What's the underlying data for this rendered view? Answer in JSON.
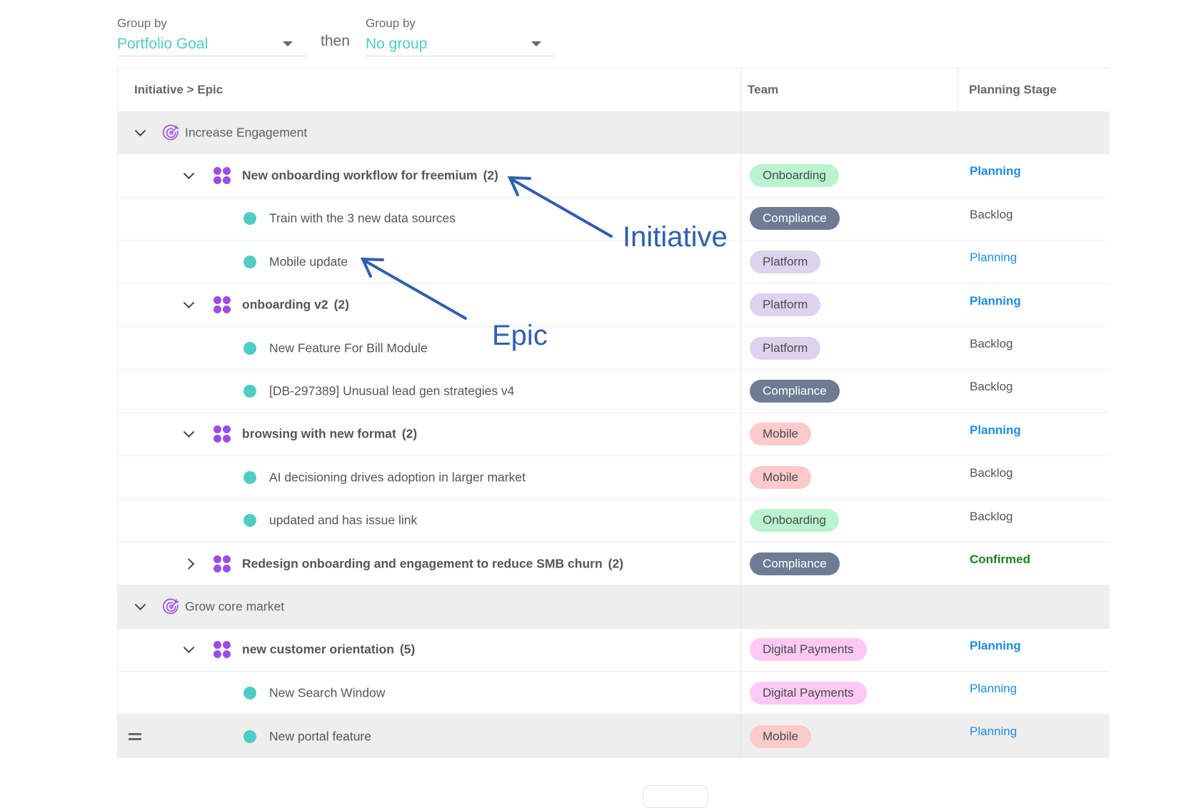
{
  "group_by_1": {
    "label": "Group by",
    "value": "Portfolio Goal"
  },
  "then_label": "then",
  "group_by_2": {
    "label": "Group by",
    "value": "No group"
  },
  "columns": {
    "name": "Initiative > Epic",
    "team": "Team",
    "stage": "Planning Stage"
  },
  "team_colors": {
    "Onboarding": {
      "bg": "#b9f3d0",
      "fg": "#4a4a4a"
    },
    "Compliance": {
      "bg": "#6e7b94",
      "fg": "#ffffff"
    },
    "Platform": {
      "bg": "#ddd3ee",
      "fg": "#4a4a4a"
    },
    "Mobile": {
      "bg": "#fbcaca",
      "fg": "#4a4a4a"
    },
    "Digital Payments": {
      "bg": "#fbc9f4",
      "fg": "#4a4a4a"
    }
  },
  "rows": [
    {
      "type": "goal",
      "label": "Increase Engagement",
      "expanded": true
    },
    {
      "type": "initiative",
      "label": "New onboarding workflow for freemium",
      "count": "(2)",
      "expanded": true,
      "team": "Onboarding",
      "stage": "Planning",
      "stage_style": "planning",
      "stage_bold": true
    },
    {
      "type": "epic",
      "label": "Train with the 3 new data sources",
      "team": "Compliance",
      "stage": "Backlog",
      "stage_style": "backlog"
    },
    {
      "type": "epic",
      "label": "Mobile update",
      "team": "Platform",
      "stage": "Planning",
      "stage_style": "planning"
    },
    {
      "type": "initiative",
      "label": "onboarding v2",
      "count": "(2)",
      "expanded": true,
      "team": "Platform",
      "stage": "Planning",
      "stage_style": "planning",
      "stage_bold": true
    },
    {
      "type": "epic",
      "label": "New Feature For Bill Module",
      "team": "Platform",
      "stage": "Backlog",
      "stage_style": "backlog"
    },
    {
      "type": "epic",
      "label": "[DB-297389] Unusual lead gen strategies v4",
      "team": "Compliance",
      "stage": "Backlog",
      "stage_style": "backlog"
    },
    {
      "type": "initiative",
      "label": "browsing with new format",
      "count": "(2)",
      "expanded": true,
      "team": "Mobile",
      "stage": "Planning",
      "stage_style": "planning",
      "stage_bold": true
    },
    {
      "type": "epic",
      "label": "AI decisioning drives adoption in larger market",
      "team": "Mobile",
      "stage": "Backlog",
      "stage_style": "backlog"
    },
    {
      "type": "epic",
      "label": "updated and has issue link",
      "team": "Onboarding",
      "stage": "Backlog",
      "stage_style": "backlog"
    },
    {
      "type": "initiative",
      "label": "Redesign onboarding and engagement to reduce SMB churn",
      "count": "(2)",
      "expanded": false,
      "team": "Compliance",
      "stage": "Confirmed",
      "stage_style": "confirmed",
      "stage_bold": true
    },
    {
      "type": "goal",
      "label": "Grow core market",
      "expanded": true
    },
    {
      "type": "initiative",
      "label": "new customer orientation",
      "count": "(5)",
      "expanded": true,
      "team": "Digital Payments",
      "stage": "Planning",
      "stage_style": "planning",
      "stage_bold": true
    },
    {
      "type": "epic",
      "label": "New Search Window",
      "team": "Digital Payments",
      "stage": "Planning",
      "stage_style": "planning"
    },
    {
      "type": "epic",
      "label": "New portal feature",
      "team": "Mobile",
      "stage": "Planning",
      "stage_style": "planning",
      "highlighted": true,
      "drag_handle": true
    }
  ],
  "annotations": {
    "initiative": "Initiative",
    "epic": "Epic",
    "color": "#2f5faf"
  },
  "icons": {
    "goal": "target-icon",
    "initiative": "initiative-grid-icon",
    "epic": "epic-dot-icon",
    "expand": "chevron-down-icon",
    "collapsed": "chevron-right-icon",
    "drag": "drag-handle-icon",
    "dropdown": "caret-down-icon"
  }
}
